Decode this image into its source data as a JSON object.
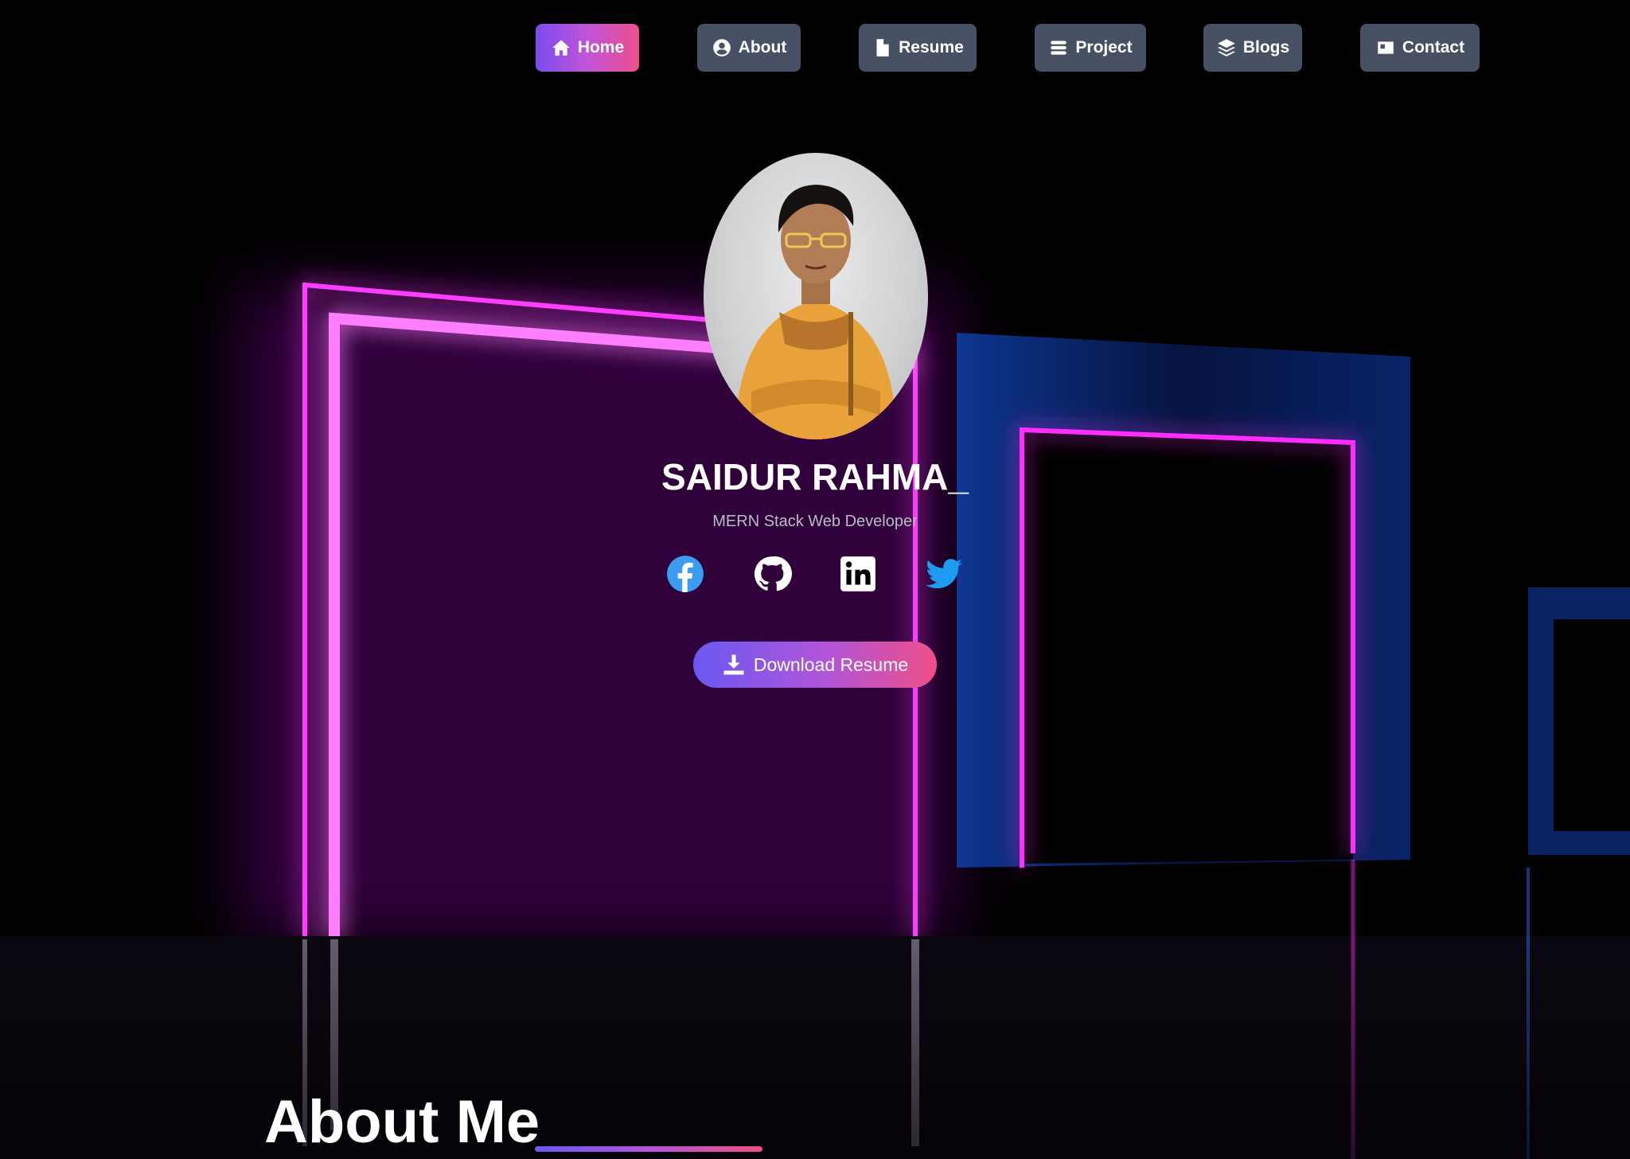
{
  "nav": {
    "items": [
      {
        "label": "Home",
        "icon": "home-icon",
        "active": true
      },
      {
        "label": "About",
        "icon": "user-circle-icon",
        "active": false
      },
      {
        "label": "Resume",
        "icon": "file-icon",
        "active": false
      },
      {
        "label": "Project",
        "icon": "server-icon",
        "active": false
      },
      {
        "label": "Blogs",
        "icon": "layers-icon",
        "active": false
      },
      {
        "label": "Contact",
        "icon": "id-card-icon",
        "active": false
      }
    ]
  },
  "profile": {
    "name": "SAIDUR RAHMA_",
    "role": "MERN Stack Web Developer",
    "social": [
      {
        "name": "facebook",
        "icon": "facebook-icon",
        "color": "#3b9cf1"
      },
      {
        "name": "github",
        "icon": "github-icon",
        "color": "#ffffff"
      },
      {
        "name": "linkedin",
        "icon": "linkedin-icon",
        "color": "#ffffff"
      },
      {
        "name": "twitter",
        "icon": "twitter-icon",
        "color": "#1d9bf0"
      }
    ],
    "download_label": "Download Resume"
  },
  "about": {
    "title": "About Me"
  },
  "colors": {
    "accent_start": "#6a58f2",
    "accent_end": "#ee4f86",
    "nav_bg": "#485163",
    "neon_pink": "#ff2dff",
    "neon_blue": "#1a5cff"
  }
}
